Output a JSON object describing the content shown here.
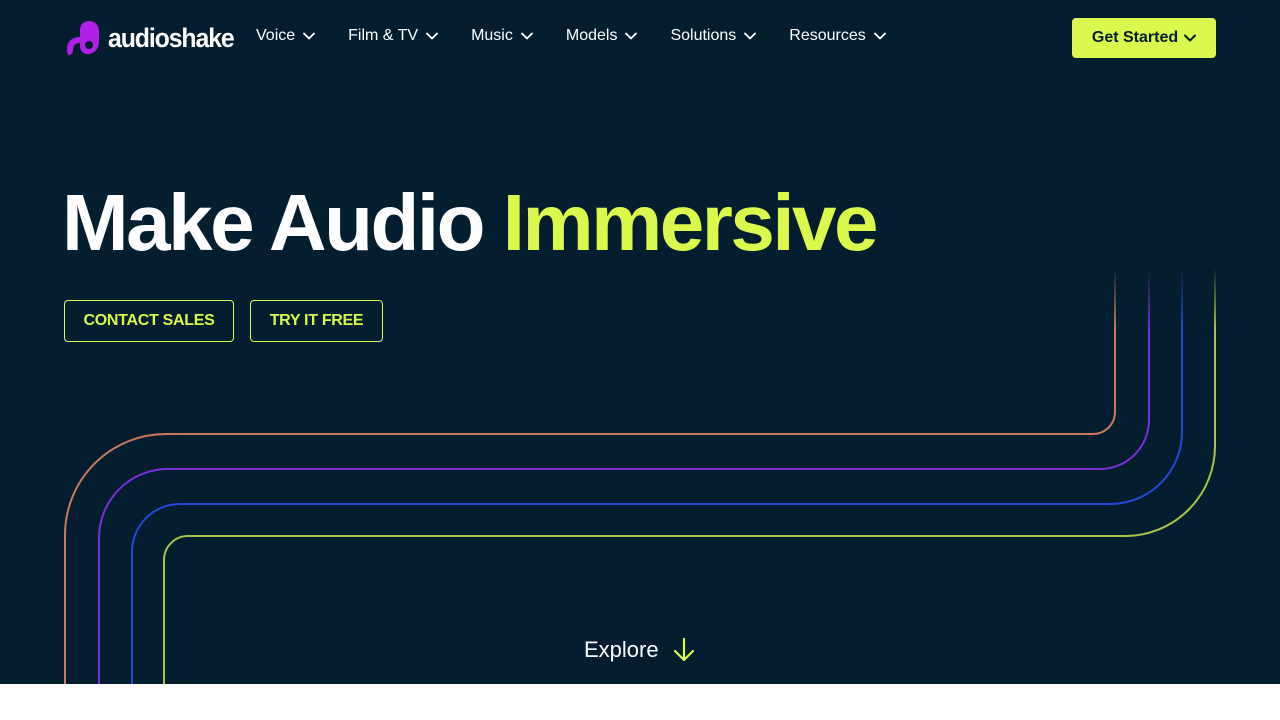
{
  "brand": {
    "name": "audioshake",
    "logo_icon": "audioshake-logo-icon",
    "logo_color": "#b11ee6"
  },
  "nav": {
    "items": [
      {
        "label": "Voice"
      },
      {
        "label": "Film & TV"
      },
      {
        "label": "Music"
      },
      {
        "label": "Models"
      },
      {
        "label": "Solutions"
      },
      {
        "label": "Resources"
      }
    ],
    "dropdown_icon": "chevron-down-icon",
    "cta_label": "Get Started"
  },
  "hero": {
    "headline_part1": "Make Audio",
    "headline_part2": "Immersive",
    "buttons": {
      "contact_sales": "CONTACT SALES",
      "try_free": "TRY IT FREE"
    },
    "explore_label": "Explore",
    "explore_icon": "arrow-down-icon"
  },
  "colors": {
    "background": "#041e2f",
    "accent": "#dbf84d",
    "text": "#ffffff",
    "line_colors": [
      "#c97a5e",
      "#7a2ed6",
      "#2449d8",
      "#a9c24a"
    ]
  }
}
